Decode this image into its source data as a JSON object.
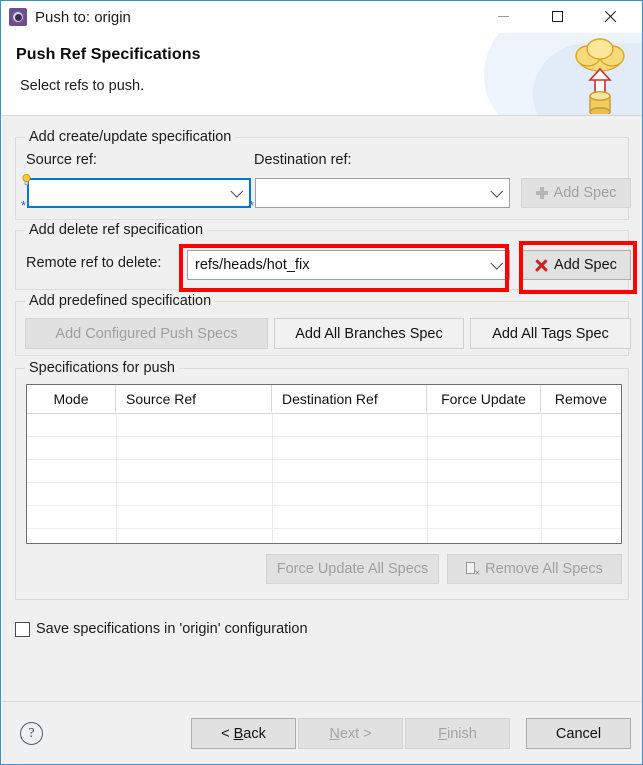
{
  "window": {
    "title": "Push to: origin",
    "app_icon": "push-gear-icon",
    "controls": {
      "minimize": "minimize-icon",
      "maximize": "maximize-icon",
      "close": "close-icon"
    }
  },
  "header": {
    "title": "Push Ref Specifications",
    "subtitle": "Select refs to push.",
    "banner_icon": "cloud-upload-database-icon"
  },
  "groups": {
    "create_update": {
      "legend": "Add create/update specification",
      "source_label": "Source ref:",
      "source_value": "",
      "destination_label": "Destination ref:",
      "destination_value": "",
      "add_spec_label": "Add Spec",
      "add_spec_icon": "plus-icon",
      "source_decoration_icon": "lightbulb-icon",
      "required_marker": "*"
    },
    "delete_ref": {
      "legend": "Add delete ref specification",
      "remote_label": "Remote ref to delete:",
      "remote_value": "refs/heads/hot_fix",
      "add_spec_label": "Add Spec",
      "add_spec_icon": "red-x-icon"
    },
    "predefined": {
      "legend": "Add predefined specification",
      "configured_label": "Add Configured Push Specs",
      "all_branches_label": "Add All Branches Spec",
      "all_tags_label": "Add All Tags Spec"
    },
    "specs_for_push": {
      "legend": "Specifications for push",
      "columns": [
        "Mode",
        "Source Ref",
        "Destination Ref",
        "Force Update",
        "Remove"
      ],
      "rows": [],
      "empty_row_count": 7,
      "force_update_all_label": "Force Update All Specs",
      "remove_all_label": "Remove All Specs",
      "remove_all_icon": "document-delete-icon"
    }
  },
  "save_option": {
    "label": "Save specifications in 'origin' configuration",
    "checked": false
  },
  "footer": {
    "help_icon": "help-question-icon",
    "back_label": "< Back",
    "back_mnemonic": "B",
    "next_label": "Next >",
    "next_mnemonic": "N",
    "finish_label": "Finish",
    "finish_mnemonic": "F",
    "cancel_label": "Cancel"
  },
  "annotations": {
    "color": "#ff0000",
    "boxes": [
      {
        "name": "remote-ref-combo-highlight"
      },
      {
        "name": "delete-add-spec-button-highlight"
      }
    ]
  }
}
